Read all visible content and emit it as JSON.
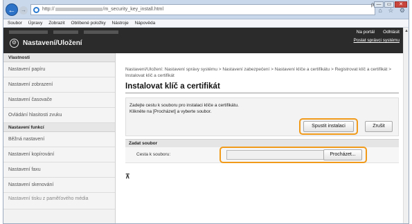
{
  "browser": {
    "address_prefix": "http://",
    "address_suffix": "/m_security_key_install.html",
    "address_tools": "ρ - ¢",
    "tab_icons": "⌂ ☆ ⚙",
    "window_buttons": [
      "—",
      "▭",
      "✕"
    ]
  },
  "menu": [
    "Soubor",
    "Úpravy",
    "Zobrazit",
    "Oblíbené položky",
    "Nástroje",
    "Nápověda"
  ],
  "header": {
    "title": "Nastavení/Uložení",
    "portal_link": "Na portál",
    "logout_link": "Odhlásit",
    "mail_link": "Poslat správci systému"
  },
  "sidebar": {
    "section1": "Vlastnosti",
    "items1": [
      "Nastavení papíru",
      "Nastavení zobrazení",
      "Nastavení časovače",
      "Ovládání hlasitosti zvuku"
    ],
    "section2": "Nastavení funkcí",
    "items2": [
      "Běžná nastavení",
      "Nastavení kopírování",
      "Nastavení faxu",
      "Nastavení skenování"
    ],
    "last_item": "Nastavení tisku z paměťového média"
  },
  "main": {
    "breadcrumb": "Nastavení/Uložení: Nastavení správy systému > Nastavení zabezpečení > Nastavení klíče a certifikátu > Registrovat klíč a certifikát > Instalovat klíč a certifikát",
    "title": "Instalovat klíč a certifikát",
    "instruction1": "Zadejte cestu k souboru pro instalaci klíče a certifikátu.",
    "instruction2": "Klikněte na [Procházet] a vyberte soubor.",
    "start_button": "Spustit instalaci",
    "cancel_button": "Zrušit",
    "section_title": "Zadat soubor",
    "path_label": "Cesta k souboru:",
    "browse_button": "Procházet...",
    "top_link": "⊼"
  },
  "colors": {
    "header_bg": "#2b2b2b",
    "highlight": "#f19a1a"
  }
}
